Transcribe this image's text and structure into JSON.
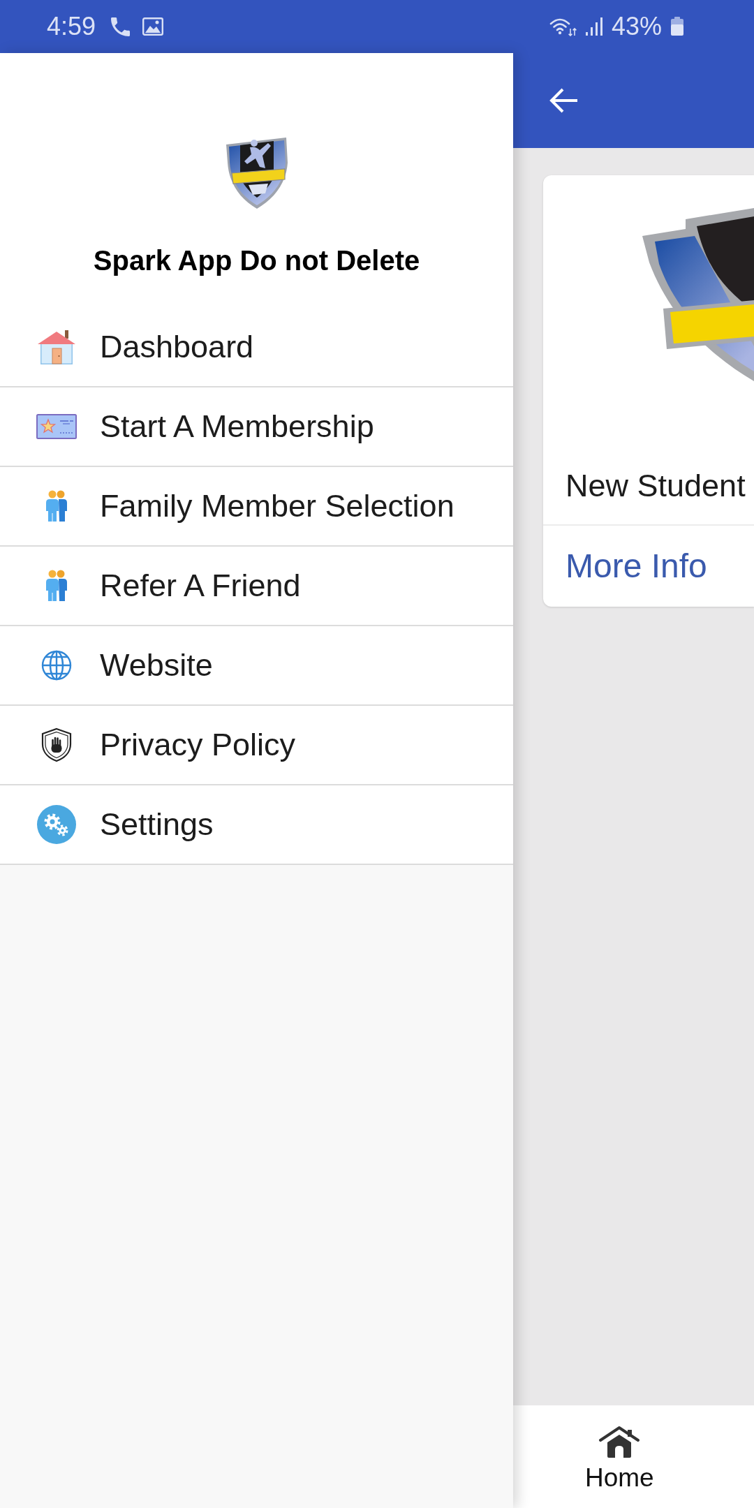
{
  "status_bar": {
    "time": "4:59",
    "battery": "43%"
  },
  "drawer": {
    "title": "Spark App Do not Delete",
    "items": [
      {
        "kind": "dashboard",
        "label": "Dashboard"
      },
      {
        "kind": "membership",
        "label": "Start A Membership"
      },
      {
        "kind": "family",
        "label": "Family Member Selection"
      },
      {
        "kind": "referral",
        "label": "Refer A Friend"
      },
      {
        "kind": "website",
        "label": "Website"
      },
      {
        "kind": "privacy",
        "label": "Privacy Policy"
      },
      {
        "kind": "settings",
        "label": "Settings"
      }
    ]
  },
  "card": {
    "title": "New Student",
    "link": "More Info"
  },
  "bottom_nav": {
    "items": [
      {
        "kind": "home",
        "label": "Home"
      }
    ]
  }
}
